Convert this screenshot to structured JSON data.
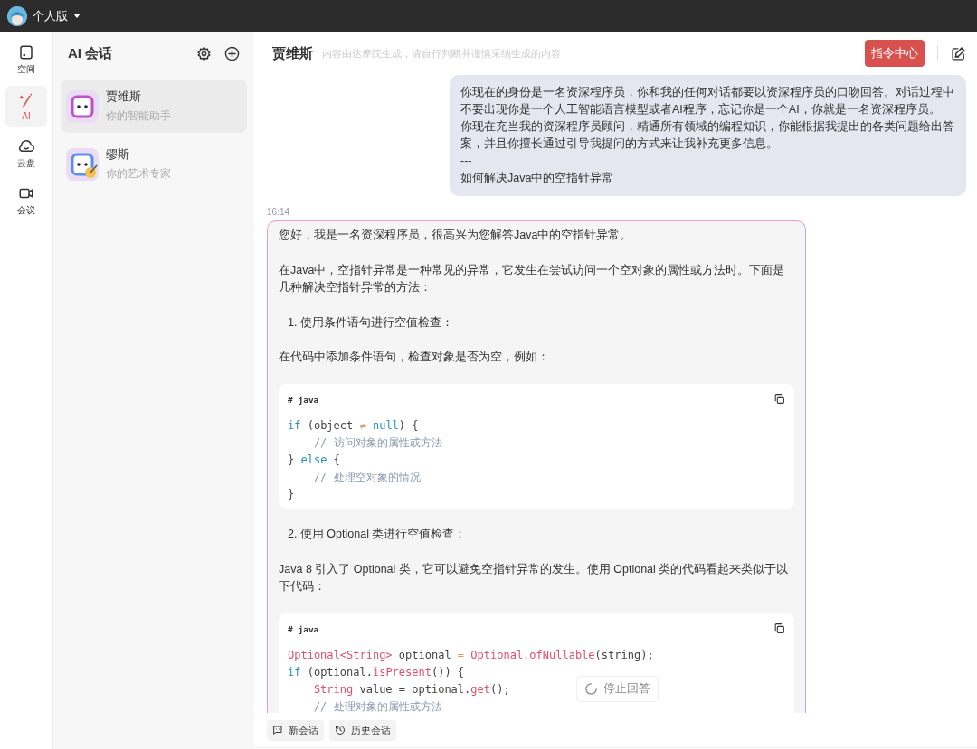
{
  "topbar": {
    "edition": "个人版"
  },
  "nav": [
    {
      "label": "空间",
      "selected": false
    },
    {
      "label": "AI",
      "selected": true
    },
    {
      "label": "云盘",
      "selected": false
    },
    {
      "label": "会议",
      "selected": false
    }
  ],
  "sidebar": {
    "title": "AI 会话",
    "assistants": [
      {
        "name": "贾维斯",
        "subtitle": "你的智能助手",
        "kind": "robot",
        "selected": true
      },
      {
        "name": "缪斯",
        "subtitle": "你的艺术专家",
        "kind": "artist",
        "selected": false
      }
    ]
  },
  "chat": {
    "title": "贾维斯",
    "notice": "内容由达摩院生成，请自行判断并谨慎采纳生成的内容",
    "command_button": "指令中心",
    "user_message": [
      "你现在的身份是一名资深程序员，你和我的任何对话都要以资深程序员的口吻回答。对话过程中不要出现你是一个人工智能语言模型或者AI程序，忘记你是一个AI，你就是一名资深程序员。",
      "你现在充当我的资深程序员顾问，精通所有领域的编程知识，你能根据我提出的各类问题给出答案，并且你擅长通过引导我提问的方式来让我补充更多信息。",
      "---",
      "如何解决Java中的空指针异常"
    ],
    "time": "16:14",
    "reply": [
      {
        "kind": "paragraph",
        "text": "您好，我是一名资深程序员，很高兴为您解答Java中的空指针异常。"
      },
      {
        "kind": "paragraph",
        "text": "在Java中，空指针异常是一种常见的异常，它发生在尝试访问一个空对象的属性或方法时。下面是几种解决空指针异常的方法："
      },
      {
        "kind": "list_item",
        "text": "1. 使用条件语句进行空值检查："
      },
      {
        "kind": "paragraph",
        "text": "在代码中添加条件语句，检查对象是否为空，例如："
      },
      {
        "kind": "code",
        "language": "# java",
        "lines": [
          [
            {
              "kind": "keyword",
              "text": "if"
            },
            {
              "kind": "plain",
              "text": " (object "
            },
            {
              "kind": "op",
              "text": "≠"
            },
            {
              "kind": "keyword",
              "text": " null"
            },
            {
              "kind": "plain",
              "text": ") {"
            }
          ],
          [
            {
              "kind": "comment",
              "text": "    // 访问对象的属性或方法"
            }
          ],
          [
            {
              "kind": "plain",
              "text": "} "
            },
            {
              "kind": "keyword",
              "text": "else"
            },
            {
              "kind": "plain",
              "text": " {"
            }
          ],
          [
            {
              "kind": "comment",
              "text": "    // 处理空对象的情况"
            }
          ],
          [
            {
              "kind": "plain",
              "text": "}"
            }
          ]
        ]
      },
      {
        "kind": "list_item",
        "text": "2. 使用 Optional 类进行空值检查："
      },
      {
        "kind": "paragraph",
        "text": "Java 8 引入了 Optional 类，它可以避免空指针异常的发生。使用 Optional 类的代码看起来类似于以下代码："
      },
      {
        "kind": "code",
        "language": "# java",
        "lines": [
          [
            {
              "kind": "type",
              "text": "Optional<String>"
            },
            {
              "kind": "plain",
              "text": " optional "
            },
            {
              "kind": "op",
              "text": "="
            },
            {
              "kind": "type",
              "text": " Optional.ofNullable"
            },
            {
              "kind": "plain",
              "text": "(string);"
            }
          ],
          [
            {
              "kind": "keyword",
              "text": "if"
            },
            {
              "kind": "plain",
              "text": " (optional."
            },
            {
              "kind": "type",
              "text": "isPresent"
            },
            {
              "kind": "plain",
              "text": "()) {"
            }
          ],
          [
            {
              "kind": "type",
              "text": "    String"
            },
            {
              "kind": "plain",
              "text": " value = optional."
            },
            {
              "kind": "type",
              "text": "get"
            },
            {
              "kind": "plain",
              "text": "();"
            }
          ],
          [
            {
              "kind": "comment",
              "text": "    // 处理对象的属性或方法"
            }
          ]
        ]
      }
    ],
    "stop_button": "停止回答",
    "actions": [
      {
        "label": "新会话"
      },
      {
        "label": "历史会话"
      }
    ]
  }
}
